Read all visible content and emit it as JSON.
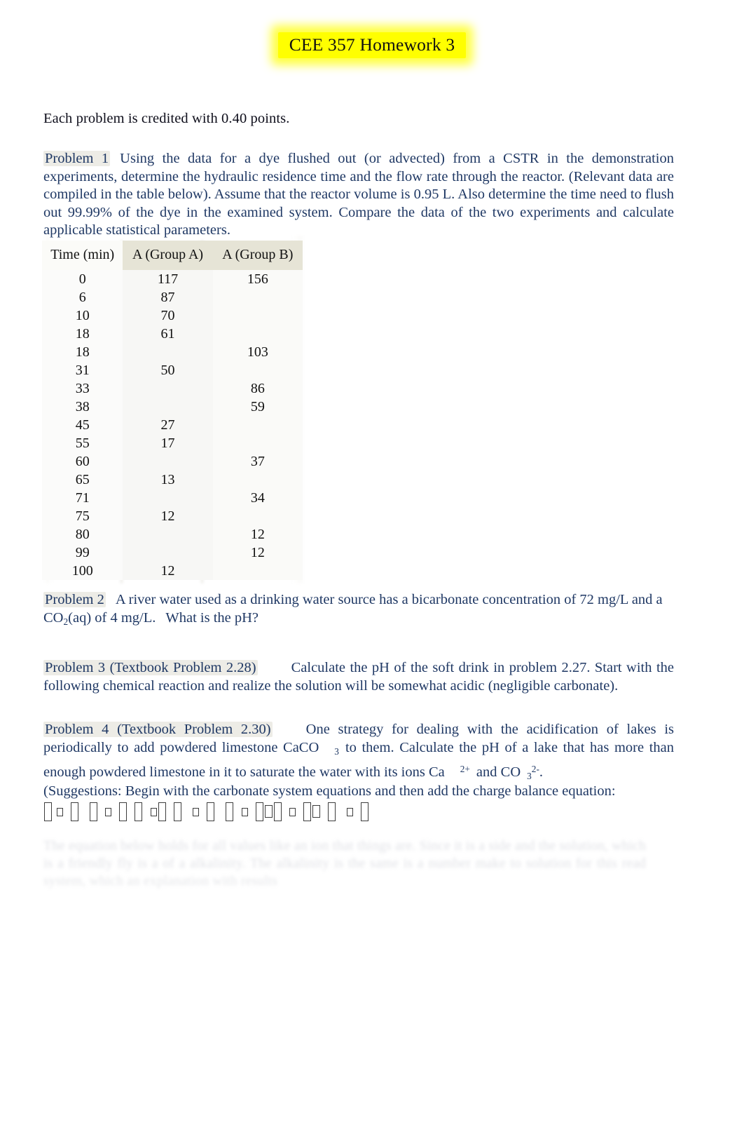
{
  "document": {
    "title": "CEE 357 Homework 3",
    "intro": "Each problem is credited with 0.40 points."
  },
  "problem1": {
    "label": "Problem 1",
    "text_a": "Using the data for a dye flushed out (or advected) from a CSTR in the demonstration experiments, determine the hydraulic residence time and the flow rate through the reactor. (Relevant data are compiled in the table below). Assume that the reactor volume is 0.95 L. Also determine the time need to flush out 99.99% of the dye in the examined system. Compare the data of the two experiments and calculate applicable statistical parameters."
  },
  "table": {
    "headers": [
      "Time (min)",
      "A (Group A)",
      "A (Group B)"
    ],
    "rows": [
      [
        "0",
        "117",
        "156"
      ],
      [
        "6",
        "87",
        ""
      ],
      [
        "10",
        "70",
        ""
      ],
      [
        "18",
        "61",
        ""
      ],
      [
        "18",
        "",
        "103"
      ],
      [
        "31",
        "50",
        ""
      ],
      [
        "33",
        "",
        "86"
      ],
      [
        "38",
        "",
        "59"
      ],
      [
        "45",
        "27",
        ""
      ],
      [
        "55",
        "17",
        ""
      ],
      [
        "60",
        "",
        "37"
      ],
      [
        "65",
        "13",
        ""
      ],
      [
        "71",
        "",
        "34"
      ],
      [
        "75",
        "12",
        ""
      ],
      [
        "80",
        "",
        "12"
      ],
      [
        "99",
        "",
        "12"
      ],
      [
        "100",
        "12",
        ""
      ]
    ]
  },
  "problem2": {
    "label": "Problem 2",
    "text_a": "A river water used as a drinking water source has a bicarbonate concentration of 72 mg/L and a CO",
    "sub_1": "2",
    "text_b": "(aq) of 4 mg/L.",
    "text_c": "What is the pH?"
  },
  "problem3": {
    "label": "Problem 3 (Textbook Problem 2.28)",
    "text_a": "Calculate the pH of the soft drink in problem 2.27. Start with the following chemical reaction and realize the solution will be somewhat acidic (negligible carbonate)."
  },
  "problem4": {
    "label": "Problem 4 (Textbook Problem 2.30)",
    "text_a": "One strategy for dealing with the acidification of lakes is periodically to add powdered limestone CaCO",
    "sub_1": "3",
    "text_b": "to them. Calculate the pH of a lake that has more than enough powdered limestone in it to saturate the water with its ions Ca",
    "sup_1": "2+",
    "text_c": "and CO",
    "sub_2": "3",
    "sup_2": "2-",
    "text_d": "."
  },
  "suggestions": {
    "text": "(Suggestions: Begin with the carbonate system equations and then add the charge balance equation:"
  },
  "equation_row": {
    "note": "missing-glyph placeholder boxes"
  },
  "ghost_text": {
    "line1": "The equation below holds for all values like an ion that things are. Since it is a side and the solution, which is a",
    "line2": "friendly fly is a of a alkalinity. The alkalinity is the same is a number make to solution for this read",
    "system": "system, which an explanation with results"
  },
  "colors": {
    "title_highlight": "#ffff00",
    "body_text": "#1F3864",
    "intro_text": "#0d0d1a",
    "table_header_bg": "#E6E4D6",
    "label_highlight": "#D8D4C8"
  }
}
